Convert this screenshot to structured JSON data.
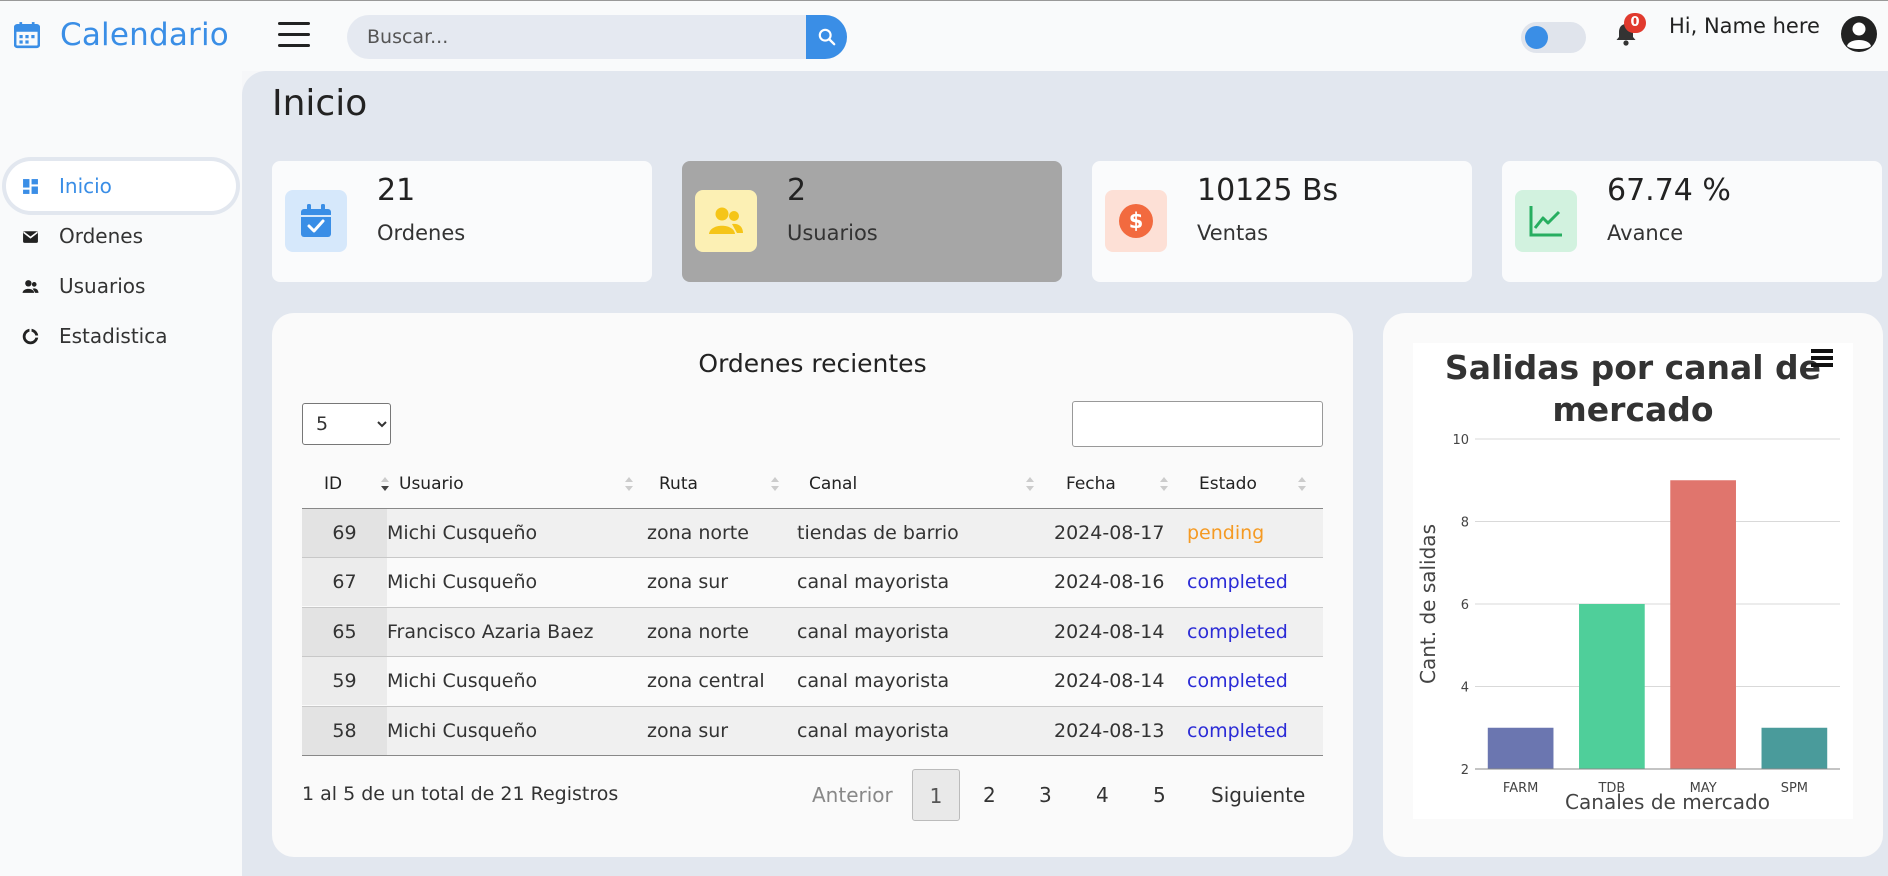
{
  "app": {
    "title": "Calendario"
  },
  "search": {
    "placeholder": "Buscar..."
  },
  "notifications": {
    "count": "0"
  },
  "user": {
    "greeting": "Hi, Name here"
  },
  "sidebar": {
    "items": [
      {
        "label": "Inicio",
        "icon": "dashboard-icon",
        "active": true
      },
      {
        "label": "Ordenes",
        "icon": "envelope-icon"
      },
      {
        "label": "Usuarios",
        "icon": "users-icon"
      },
      {
        "label": "Estadistica",
        "icon": "pie-chart-icon"
      }
    ]
  },
  "page": {
    "title": "Inicio"
  },
  "cards": [
    {
      "value": "21",
      "label": "Ordenes",
      "icon": "calendar-check-icon",
      "color": "#3a8ee6"
    },
    {
      "value": "2",
      "label": "Usuarios",
      "icon": "users-icon",
      "color": "#f5c518"
    },
    {
      "value": "10125 Bs",
      "label": "Ventas",
      "icon": "dollar-icon",
      "color": "#f26a3f"
    },
    {
      "value": "67.74 %",
      "label": "Avance",
      "icon": "line-chart-icon",
      "color": "#27ae60"
    }
  ],
  "orders": {
    "title": "Ordenes recientes",
    "page_size": "5",
    "columns": [
      "ID",
      "Usuario",
      "Ruta",
      "Canal",
      "Fecha",
      "Estado"
    ],
    "rows": [
      {
        "id": "69",
        "usuario": "Michi Cusqueño",
        "ruta": "zona norte",
        "canal": "tiendas de barrio",
        "fecha": "2024-08-17",
        "estado": "pending"
      },
      {
        "id": "67",
        "usuario": "Michi Cusqueño",
        "ruta": "zona sur",
        "canal": "canal mayorista",
        "fecha": "2024-08-16",
        "estado": "completed"
      },
      {
        "id": "65",
        "usuario": "Francisco Azaria Baez",
        "ruta": "zona norte",
        "canal": "canal mayorista",
        "fecha": "2024-08-14",
        "estado": "completed"
      },
      {
        "id": "59",
        "usuario": "Michi Cusqueño",
        "ruta": "zona central",
        "canal": "canal mayorista",
        "fecha": "2024-08-14",
        "estado": "completed"
      },
      {
        "id": "58",
        "usuario": "Michi Cusqueño",
        "ruta": "zona sur",
        "canal": "canal mayorista",
        "fecha": "2024-08-13",
        "estado": "completed"
      }
    ],
    "info": "1 al 5 de un total de 21 Registros",
    "pagination": {
      "prev": "Anterior",
      "pages": [
        "1",
        "2",
        "3",
        "4",
        "5"
      ],
      "current": "1",
      "next": "Siguiente"
    }
  },
  "chart_data": {
    "type": "bar",
    "title": "Salidas por canal de mercado",
    "categories": [
      "FARM",
      "TDB",
      "MAY",
      "SPM"
    ],
    "values": [
      3,
      6,
      9,
      3
    ],
    "colors": [
      "#6b76b0",
      "#4fcf9a",
      "#e0756d",
      "#4a9b9b"
    ],
    "xlabel": "Canales de mercado",
    "ylabel": "Cant. de salidas",
    "ylim": [
      2,
      10
    ],
    "yticks": [
      "2",
      "4",
      "6",
      "8",
      "10"
    ],
    "grid": true
  }
}
